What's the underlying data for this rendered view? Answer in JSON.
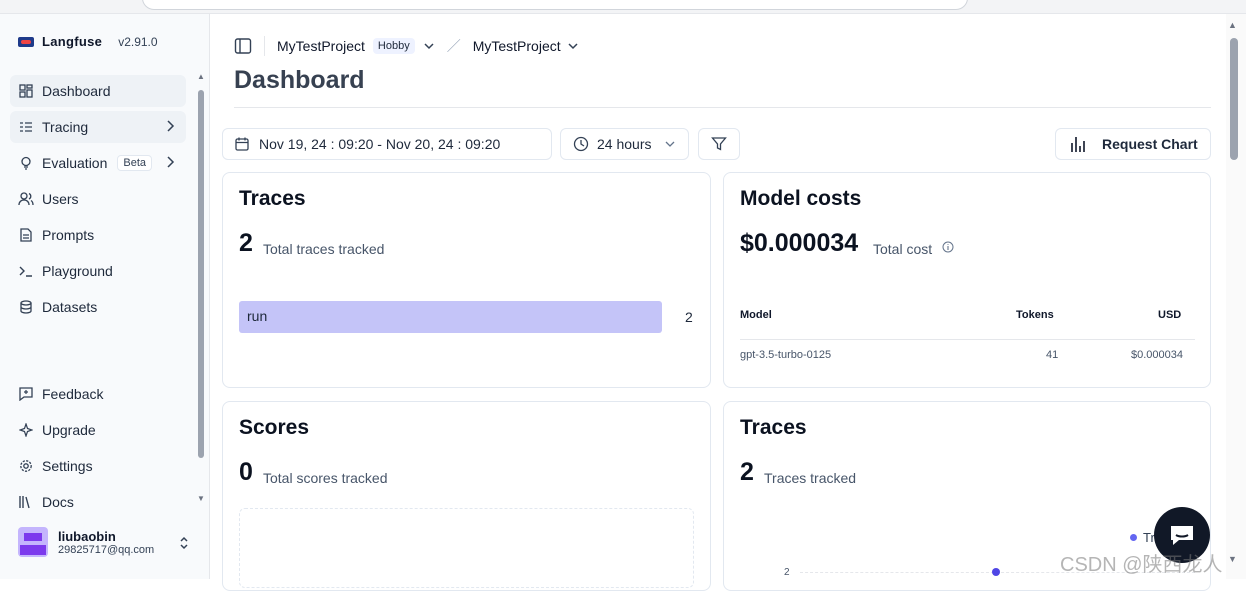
{
  "app": {
    "name": "Langfuse",
    "version": "v2.91.0"
  },
  "sidebar": {
    "items": [
      {
        "label": "Dashboard",
        "icon": "grid-icon"
      },
      {
        "label": "Tracing",
        "icon": "list-tree-icon"
      },
      {
        "label": "Evaluation",
        "badge": "Beta",
        "icon": "lightbulb-icon"
      },
      {
        "label": "Users",
        "icon": "users-icon"
      },
      {
        "label": "Prompts",
        "icon": "file-text-icon"
      },
      {
        "label": "Playground",
        "icon": "terminal-icon"
      },
      {
        "label": "Datasets",
        "icon": "database-icon"
      }
    ],
    "bottom_items": [
      {
        "label": "Feedback",
        "icon": "message-square-icon"
      },
      {
        "label": "Upgrade",
        "icon": "sparkle-icon"
      },
      {
        "label": "Settings",
        "icon": "gear-icon"
      },
      {
        "label": "Docs",
        "icon": "library-icon"
      }
    ],
    "user": {
      "name": "liubaobin",
      "email": "29825717@qq.com"
    }
  },
  "header": {
    "org": "MyTestProject",
    "plan": "Hobby",
    "project": "MyTestProject",
    "title": "Dashboard"
  },
  "filters": {
    "date_range": "Nov 19, 24 : 09:20 - Nov 20, 24 : 09:20",
    "preset": "24 hours",
    "request_chart": "Request Chart"
  },
  "cards": {
    "traces": {
      "title": "Traces",
      "count": "2",
      "count_label": "Total traces tracked",
      "bars": [
        {
          "name": "run",
          "value": "2"
        }
      ]
    },
    "model_costs": {
      "title": "Model costs",
      "total": "$0.000034",
      "total_label": "Total cost",
      "columns": [
        "Model",
        "Tokens",
        "USD"
      ],
      "rows": [
        {
          "model": "gpt-3.5-turbo-0125",
          "tokens": "41",
          "usd": "$0.000034"
        }
      ]
    },
    "scores": {
      "title": "Scores",
      "count": "0",
      "count_label": "Total scores tracked"
    },
    "traces_chart": {
      "title": "Traces",
      "count": "2",
      "count_label": "Traces tracked",
      "legend": "Tr",
      "y_tick": "2"
    }
  },
  "watermark": "CSDN @陕西龙人"
}
